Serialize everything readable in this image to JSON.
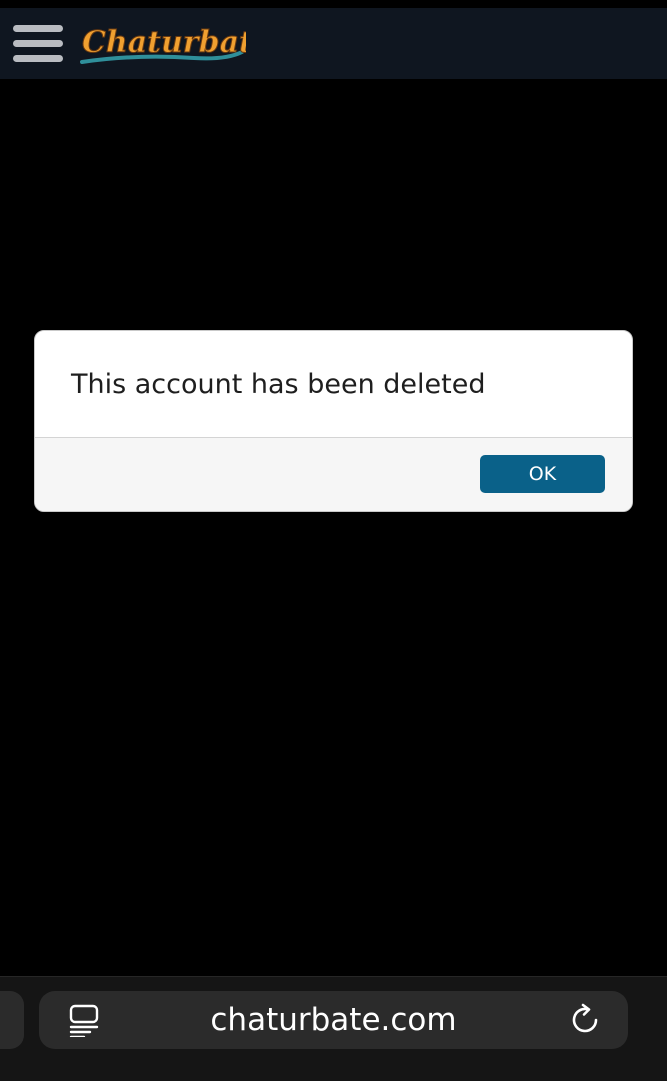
{
  "header": {
    "menu_icon": "hamburger-menu-icon",
    "logo_text": "Chaturbate"
  },
  "dialog": {
    "message": "This account has been deleted",
    "ok_label": "OK",
    "accent": "#0a6189"
  },
  "browser_bar": {
    "url": "chaturbate.com",
    "reader_icon": "reader-mode-icon",
    "reload_icon": "reload-icon"
  },
  "colors": {
    "header_bg": "#0f1620",
    "page_bg": "#000000",
    "logo_orange": "#f0a030",
    "logo_teal": "#2f8f9a"
  }
}
